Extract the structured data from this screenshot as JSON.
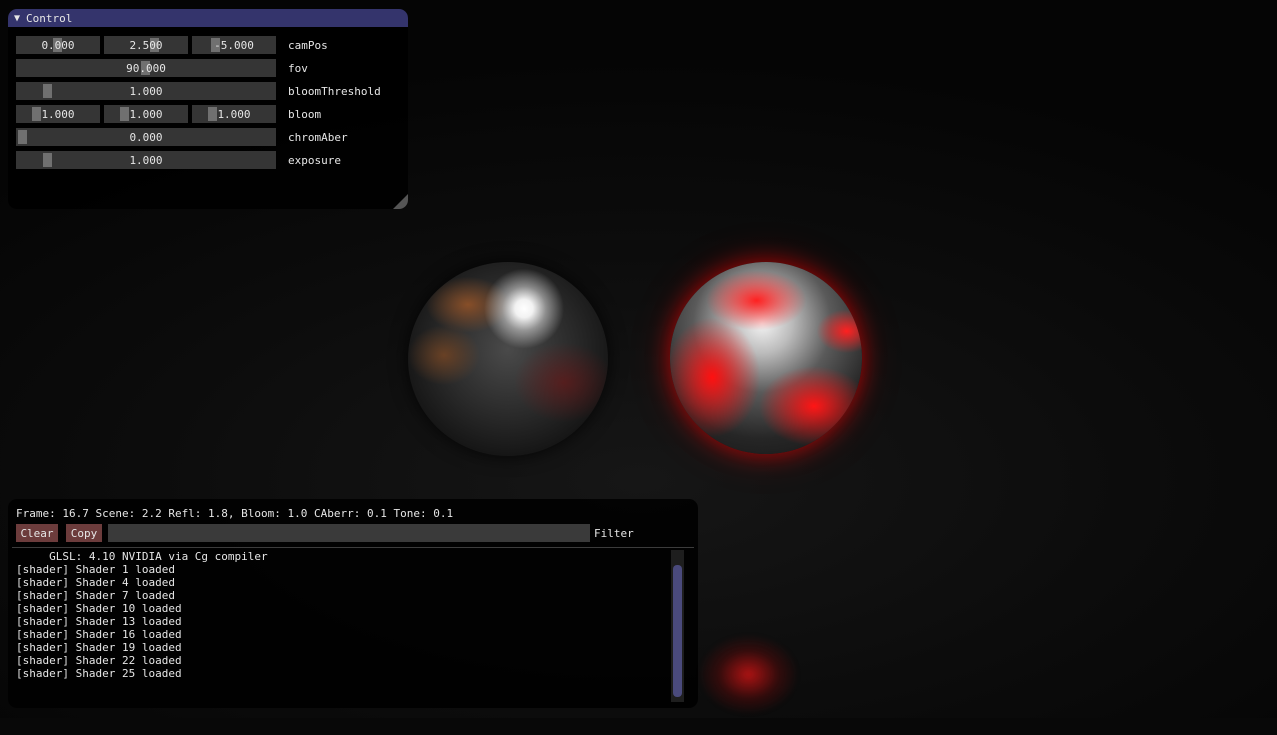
{
  "control_window": {
    "title": "Control",
    "rows": [
      {
        "label": "camPos",
        "values": [
          "0.000",
          "2.500",
          "-5.000"
        ]
      },
      {
        "label": "fov",
        "values": [
          "90.000"
        ]
      },
      {
        "label": "bloomThreshold",
        "values": [
          "1.000"
        ]
      },
      {
        "label": "bloom",
        "values": [
          "1.000",
          "1.000",
          "1.000"
        ]
      },
      {
        "label": "chromAber",
        "values": [
          "0.000"
        ]
      },
      {
        "label": "exposure",
        "values": [
          "1.000"
        ]
      }
    ]
  },
  "log_window": {
    "stats": "Frame: 16.7 Scene: 2.2 Refl: 1.8, Bloom: 1.0 CAberr: 0.1 Tone: 0.1",
    "clear_label": "Clear",
    "copy_label": "Copy",
    "filter_label": "Filter",
    "filter_value": "",
    "lines": [
      "     GLSL: 4.10 NVIDIA via Cg compiler",
      "[shader] Shader 1 loaded",
      "[shader] Shader 4 loaded",
      "[shader] Shader 7 loaded",
      "[shader] Shader 10 loaded",
      "[shader] Shader 13 loaded",
      "[shader] Shader 16 loaded",
      "[shader] Shader 19 loaded",
      "[shader] Shader 22 loaded",
      "[shader] Shader 25 loaded"
    ]
  },
  "colors": {
    "title_bar": "#34346c",
    "button": "#6c3c3c",
    "slider_bg": "#353535",
    "slider_grab": "#707070",
    "scrollbar": "#4a4a7c",
    "emissive": "#ff1010"
  }
}
